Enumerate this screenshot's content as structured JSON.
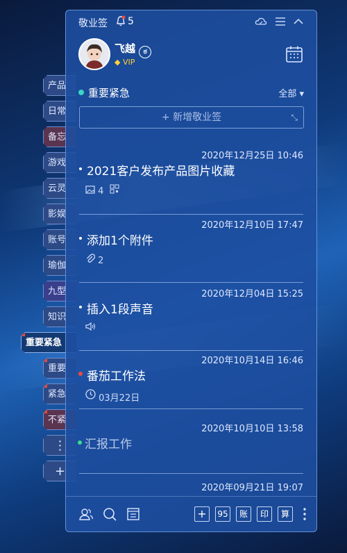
{
  "app": {
    "title": "敬业签",
    "notification_count": "5"
  },
  "user": {
    "name": "飞越",
    "badge": "VIP"
  },
  "category": {
    "current": "重要紧急",
    "filter": "全部 ▾",
    "new_note": "+ 新增敬业签"
  },
  "side_tabs": [
    {
      "label": "产品"
    },
    {
      "label": "日常"
    },
    {
      "label": "备忘"
    },
    {
      "label": "游戏"
    },
    {
      "label": "云灵"
    },
    {
      "label": "影娱"
    },
    {
      "label": "账号"
    },
    {
      "label": "瑜伽"
    },
    {
      "label": "九型"
    },
    {
      "label": "知识"
    },
    {
      "label": "重要紧急"
    },
    {
      "label": "重要"
    },
    {
      "label": "紧急"
    },
    {
      "label": "不紧"
    },
    {
      "label": "⋮"
    },
    {
      "label": "+"
    }
  ],
  "notes": [
    {
      "date": "2020年12月25日 10:46",
      "title": "2021客户发布产品图片收藏",
      "meta": "4"
    },
    {
      "date": "2020年12月10日 17:47",
      "title": "添加1个附件",
      "meta": "2"
    },
    {
      "date": "2020年12月04日 15:25",
      "title": "插入1段声音",
      "meta": ""
    },
    {
      "date": "2020年10月14日 16:46",
      "title": "番茄工作法",
      "meta": "03月22日"
    },
    {
      "date": "2020年10月10日 13:58",
      "title": "汇报工作",
      "meta": ""
    },
    {
      "date": "2020年09月21日 19:07",
      "title": "",
      "meta": ""
    }
  ],
  "footer": {
    "btn_95": "95",
    "btn_zhang": "账",
    "btn_yin": "印",
    "btn_suan": "算"
  },
  "icons": [
    "bell-icon",
    "cloud-icon",
    "menu-icon",
    "collapse-icon",
    "calendar-icon",
    "image-icon",
    "qr-icon",
    "paperclip-icon",
    "speaker-icon",
    "clock-icon",
    "users-icon",
    "search-icon",
    "notes-icon",
    "plus-icon",
    "kebab-icon"
  ],
  "colors": {
    "panel": "#1e4ea0",
    "accent_dot": "#3cd5c2",
    "urgent": "#f04a40",
    "done": "#3ddc8f"
  }
}
